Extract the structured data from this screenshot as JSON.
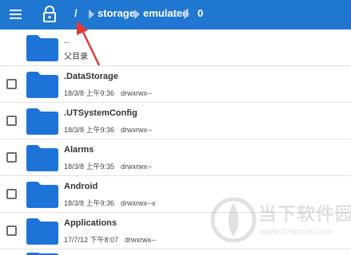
{
  "breadcrumb": {
    "root": "/",
    "items": [
      "storage",
      "emulated",
      "0"
    ]
  },
  "parent_entry": {
    "name": "..",
    "label": "父目录"
  },
  "files": [
    {
      "name": ".DataStorage",
      "date": "18/3/8 上午9:36",
      "perm": "drwxrwx--"
    },
    {
      "name": ".UTSystemConfig",
      "date": "18/3/8 上午9:36",
      "perm": "drwxrwx--"
    },
    {
      "name": "Alarms",
      "date": "18/3/8 上午9:35",
      "perm": "drwxrwx--"
    },
    {
      "name": "Android",
      "date": "18/3/8 上午9:36",
      "perm": "drwxrwx--x"
    },
    {
      "name": "Applications",
      "date": "17/7/12 下午8:07",
      "perm": "drwxrwx--"
    }
  ],
  "watermark": {
    "text": "当下软件园",
    "url": "www.downxia.com"
  },
  "colors": {
    "topbar": "#1f77d2",
    "folder": "#1e73d8",
    "arrow": "#e53935"
  }
}
